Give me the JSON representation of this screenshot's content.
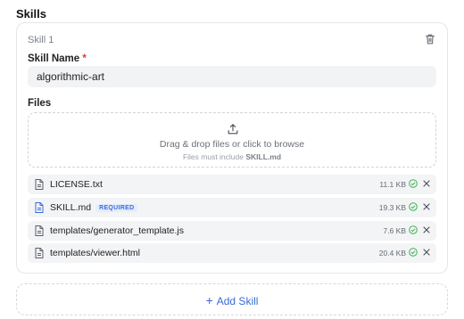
{
  "section_title": "Skills",
  "skill": {
    "header": "Skill 1",
    "name_label": "Skill Name",
    "required_mark": "*",
    "name_value": "algorithmic-art",
    "files_label": "Files",
    "dropzone": {
      "text": "Drag & drop files or click to browse",
      "sub_prefix": "Files must include",
      "sub_file": "SKILL.md"
    },
    "files": [
      {
        "name": "LICENSE.txt",
        "size": "11.1 KB",
        "badge": ""
      },
      {
        "name": "SKILL.md",
        "size": "19.3 KB",
        "badge": "REQUIRED"
      },
      {
        "name": "templates/generator_template.js",
        "size": "7.6 KB",
        "badge": ""
      },
      {
        "name": "templates/viewer.html",
        "size": "20.4 KB",
        "badge": ""
      }
    ]
  },
  "add_skill_label": "Add Skill",
  "colors": {
    "accent": "#3a6bd8",
    "success": "#3cb44b",
    "required": "#d93a3a",
    "badge_bg": "#e4ecfd"
  },
  "icons": {
    "delete": "trash-icon",
    "upload": "upload-icon",
    "file": "file-icon",
    "ok": "check-circle-icon",
    "remove": "close-icon",
    "add": "plus-icon"
  }
}
